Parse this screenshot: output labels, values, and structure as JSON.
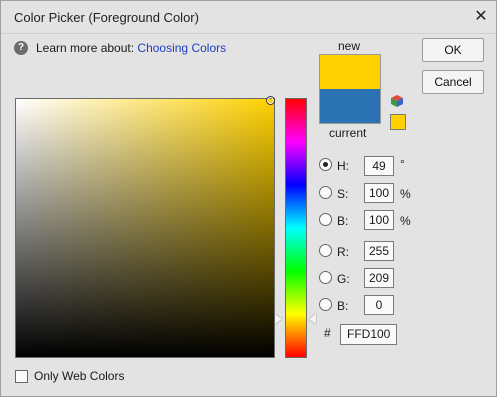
{
  "window": {
    "title": "Color Picker (Foreground Color)"
  },
  "help": {
    "prefix": "Learn more about:",
    "link": "Choosing Colors"
  },
  "preview": {
    "new_label": "new",
    "current_label": "current",
    "new_color": "#FFD100",
    "current_color": "#2A72B2"
  },
  "buttons": {
    "ok": "OK",
    "cancel": "Cancel"
  },
  "hsb": [
    {
      "label": "H:",
      "value": "49",
      "unit": "°",
      "selected": true
    },
    {
      "label": "S:",
      "value": "100",
      "unit": "%",
      "selected": false
    },
    {
      "label": "B:",
      "value": "100",
      "unit": "%",
      "selected": false
    }
  ],
  "rgb": [
    {
      "label": "R:",
      "value": "255",
      "selected": false
    },
    {
      "label": "G:",
      "value": "209",
      "selected": false
    },
    {
      "label": "B:",
      "value": "0",
      "selected": false
    }
  ],
  "hex": {
    "prefix": "#",
    "value": "FFD100"
  },
  "web_colors": {
    "label": "Only Web Colors",
    "checked": false
  },
  "icons": {
    "help": "question-circle-icon",
    "close": "close-icon",
    "websafe": "cube-icon"
  }
}
